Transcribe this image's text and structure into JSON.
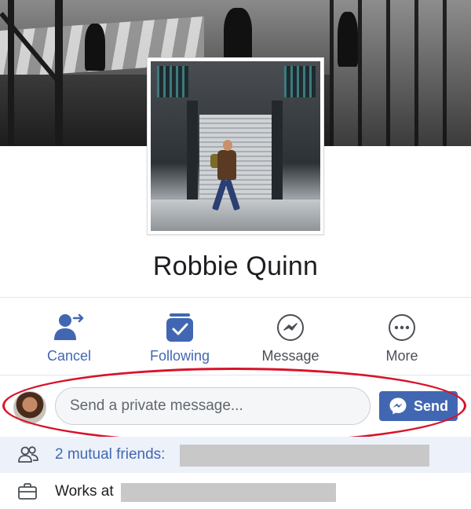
{
  "profile": {
    "name": "Robbie Quinn"
  },
  "actions": [
    {
      "label": "Cancel",
      "icon": "person-arrow-icon"
    },
    {
      "label": "Following",
      "icon": "following-check-icon"
    },
    {
      "label": "Message",
      "icon": "messenger-icon"
    },
    {
      "label": "More",
      "icon": "more-dots-icon"
    }
  ],
  "composer": {
    "placeholder": "Send a private message...",
    "send_label": "Send"
  },
  "info": {
    "mutual_friends": "2 mutual friends:",
    "works_at": "Works at"
  },
  "colors": {
    "accent": "#4267b2",
    "highlight_ellipse": "#d8132a",
    "mutual_row_bg": "#edf2fa"
  }
}
